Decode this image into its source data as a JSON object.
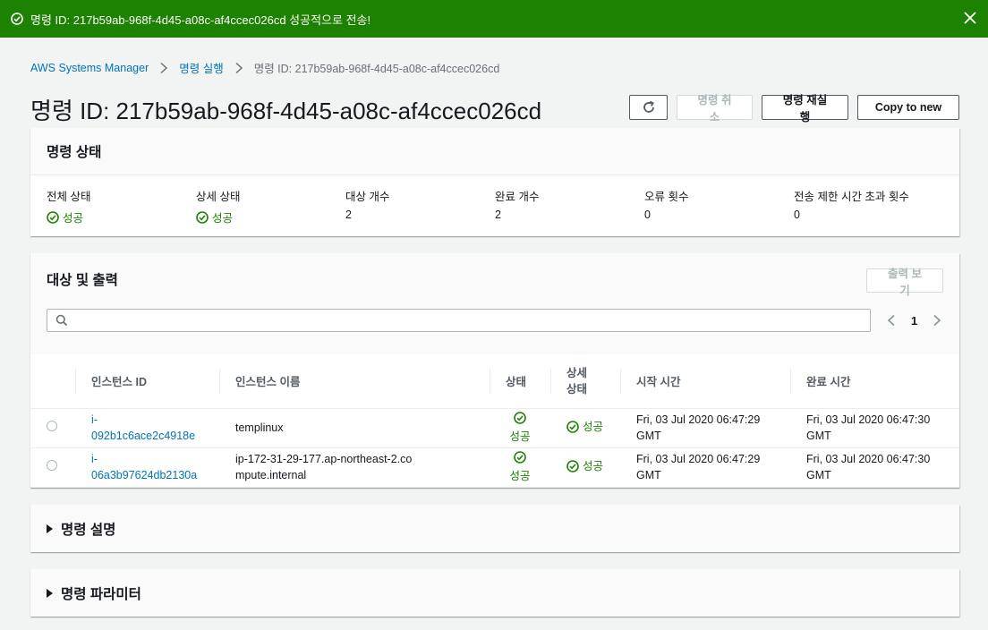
{
  "flash": {
    "message": "명령 ID: 217b59ab-968f-4d45-a08c-af4ccec026cd 성공적으로 전송!",
    "icon": "check-circle-icon",
    "close_icon": "close-icon",
    "color": "#1d8102"
  },
  "breadcrumb": {
    "items": [
      "AWS Systems Manager",
      "명령 실행",
      "명령 ID: 217b59ab-968f-4d45-a08c-af4ccec026cd"
    ]
  },
  "header": {
    "title": "명령 ID: 217b59ab-968f-4d45-a08c-af4ccec026cd",
    "refresh_icon": "refresh-icon",
    "cancel_label": "명령 취소",
    "rerun_label": "명령 재실행",
    "copy_label": "Copy to new"
  },
  "command_status": {
    "title": "명령 상태",
    "items": [
      {
        "label": "전체 상태",
        "value": "성공",
        "success": true
      },
      {
        "label": "상세 상태",
        "value": "성공",
        "success": true
      },
      {
        "label": "대상 개수",
        "value": "2"
      },
      {
        "label": "완료 개수",
        "value": "2"
      },
      {
        "label": "오류 횟수",
        "value": "0"
      },
      {
        "label": "전송 제한 시간 초과 횟수",
        "value": "0"
      }
    ]
  },
  "targets": {
    "title": "대상 및 출력",
    "view_output_label": "출력 보기",
    "search_placeholder": "",
    "page": "1",
    "columns": [
      "인스턴스 ID",
      "인스턴스 이름",
      "상태",
      "상세 상태",
      "시작 시간",
      "완료 시간"
    ],
    "rows": [
      {
        "id": "i-092b1c6ace2c4918e",
        "id_line1": "i-",
        "id_line2": "092b1c6ace2c4918e",
        "name": "templinux",
        "status": "성공",
        "detail": "성공",
        "start": "Fri, 03 Jul 2020 06:47:29 GMT",
        "end": "Fri, 03 Jul 2020 06:47:30 GMT"
      },
      {
        "id": "i-06a3b97624db2130a",
        "id_line1": "i-",
        "id_line2": "06a3b97624db2130a",
        "name": "ip-172-31-29-177.ap-northeast-2.compute.internal",
        "status": "성공",
        "detail": "성공",
        "start": "Fri, 03 Jul 2020 06:47:29 GMT",
        "end": "Fri, 03 Jul 2020 06:47:30 GMT"
      }
    ]
  },
  "description": {
    "title": "명령 설명"
  },
  "parameters": {
    "title": "명령 파라미터"
  },
  "colors": {
    "link": "#0073bb",
    "success": "#1d8102"
  }
}
